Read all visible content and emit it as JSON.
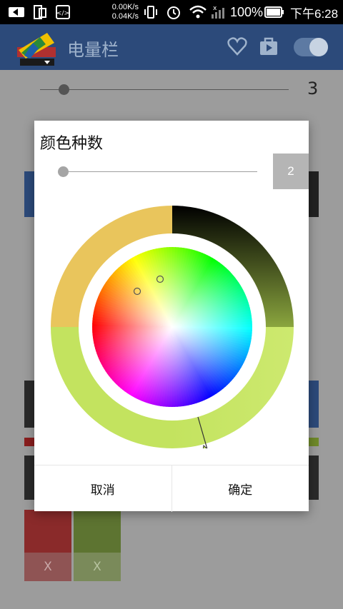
{
  "status_bar": {
    "net_up": "0.00K/s",
    "net_down": "0.04K/s",
    "battery": "100%",
    "time": "下午6:28"
  },
  "app_bar": {
    "title": "电量栏"
  },
  "background": {
    "slider_value": "3",
    "swatch_remove_1": "X",
    "swatch_remove_2": "X"
  },
  "dialog": {
    "title": "颜色种数",
    "count_value": "2",
    "slider_value_fraction": 0.0,
    "ring_colors": [
      "#e9c55c",
      "#c3e35f",
      "#000000",
      "#7a913a"
    ],
    "cancel_label": "取消",
    "ok_label": "确定"
  }
}
